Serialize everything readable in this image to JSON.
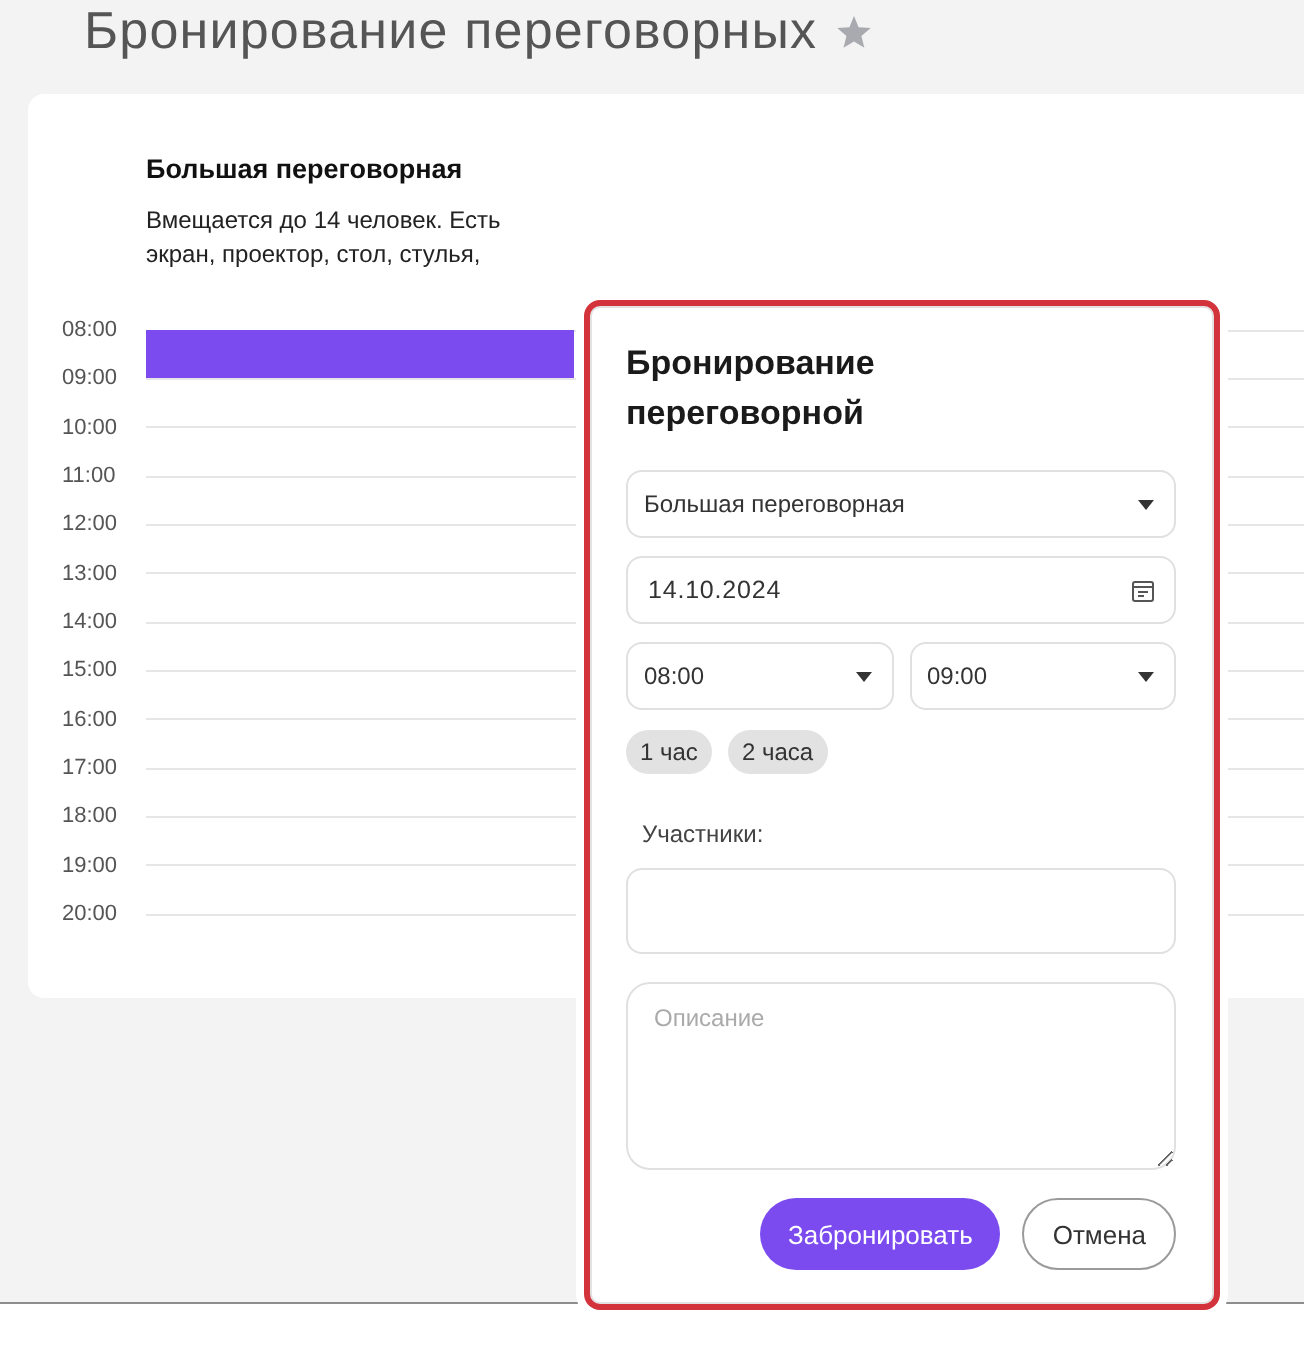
{
  "page": {
    "title": "Бронирование переговорных"
  },
  "room": {
    "name": "Большая переговорная",
    "description": "Вмещается до 14 человек. Есть экран, проектор, стол, стулья,"
  },
  "schedule": [
    {
      "time": "08:00",
      "booked": true
    },
    {
      "time": "09:00",
      "booked": false
    },
    {
      "time": "10:00",
      "booked": false
    },
    {
      "time": "11:00",
      "booked": false
    },
    {
      "time": "12:00",
      "booked": false
    },
    {
      "time": "13:00",
      "booked": false
    },
    {
      "time": "14:00",
      "booked": false
    },
    {
      "time": "15:00",
      "booked": false
    },
    {
      "time": "16:00",
      "booked": false
    },
    {
      "time": "17:00",
      "booked": false
    },
    {
      "time": "18:00",
      "booked": false
    },
    {
      "time": "19:00",
      "booked": false
    },
    {
      "time": "20:00",
      "booked": false
    }
  ],
  "booking_dialog": {
    "title": "Бронирование переговорной",
    "room_select": {
      "value": "Большая переговорная"
    },
    "date_field": {
      "value": "14.10.2024"
    },
    "start_select": {
      "value": "08:00"
    },
    "end_select": {
      "value": "09:00"
    },
    "duration_chips": [
      "1 час",
      "2 часа"
    ],
    "participants": {
      "label": "Участники:"
    },
    "description": {
      "placeholder": "Описание"
    },
    "buttons": [
      {
        "label": "Забронировать",
        "kind": "primary"
      },
      {
        "label": "Отмена",
        "kind": "secondary"
      }
    ]
  }
}
